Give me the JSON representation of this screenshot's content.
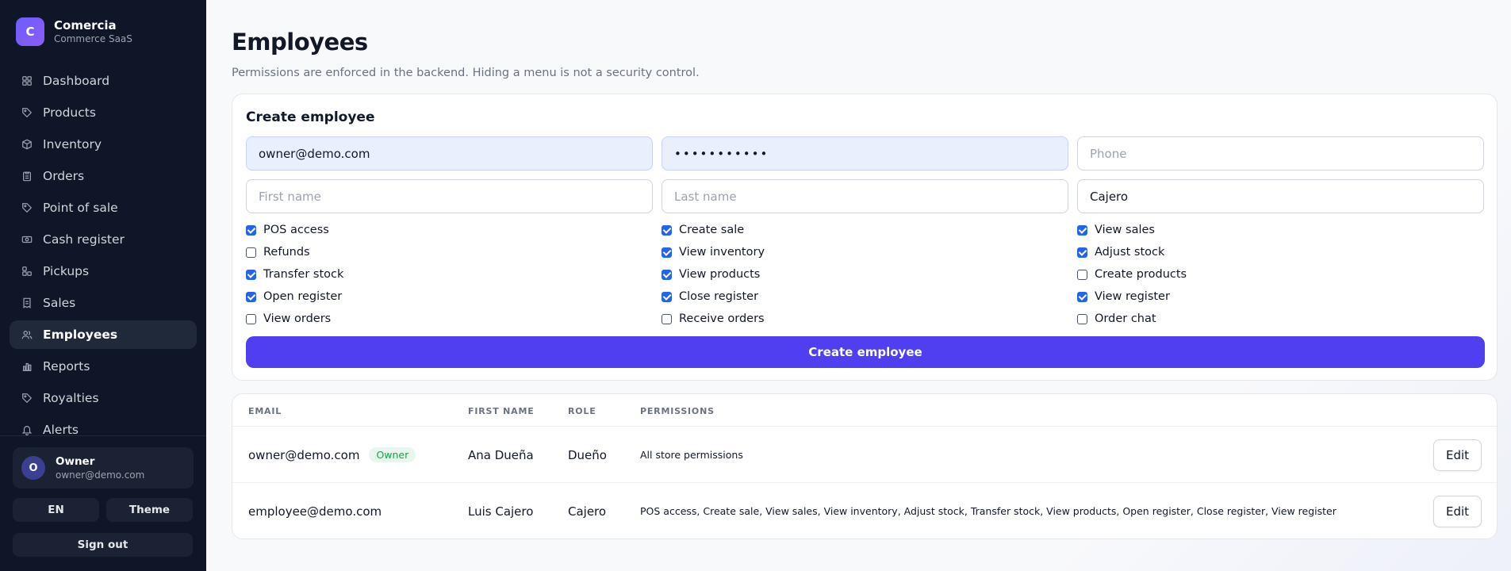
{
  "brand": {
    "initial": "C",
    "name": "Comercia",
    "subtitle": "Commerce SaaS"
  },
  "sidebar": {
    "items": [
      {
        "label": "Dashboard",
        "icon": "grid-icon",
        "active": false
      },
      {
        "label": "Products",
        "icon": "tag-icon",
        "active": false
      },
      {
        "label": "Inventory",
        "icon": "box-icon",
        "active": false
      },
      {
        "label": "Orders",
        "icon": "clipboard-icon",
        "active": false
      },
      {
        "label": "Point of sale",
        "icon": "tag-icon",
        "active": false
      },
      {
        "label": "Cash register",
        "icon": "cash-icon",
        "active": false
      },
      {
        "label": "Pickups",
        "icon": "blocks-icon",
        "active": false
      },
      {
        "label": "Sales",
        "icon": "receipt-icon",
        "active": false
      },
      {
        "label": "Employees",
        "icon": "users-icon",
        "active": true
      },
      {
        "label": "Reports",
        "icon": "bar-chart-icon",
        "active": false
      },
      {
        "label": "Royalties",
        "icon": "tag-icon",
        "active": false
      },
      {
        "label": "Alerts",
        "icon": "bell-icon",
        "active": false
      }
    ]
  },
  "user": {
    "initial": "O",
    "name": "Owner",
    "email": "owner@demo.com"
  },
  "controls": {
    "language": "EN",
    "theme": "Theme",
    "sign_out": "Sign out"
  },
  "page": {
    "title": "Employees",
    "subtitle": "Permissions are enforced in the backend. Hiding a menu is not a security control."
  },
  "form": {
    "title": "Create employee",
    "email_value": "owner@demo.com",
    "password_value": "•••••••••••",
    "phone_placeholder": "Phone",
    "first_name_placeholder": "First name",
    "last_name_placeholder": "Last name",
    "role_value": "Cajero",
    "permissions": [
      {
        "label": "POS access",
        "checked": true
      },
      {
        "label": "Create sale",
        "checked": true
      },
      {
        "label": "View sales",
        "checked": true
      },
      {
        "label": "Refunds",
        "checked": false
      },
      {
        "label": "View inventory",
        "checked": true
      },
      {
        "label": "Adjust stock",
        "checked": true
      },
      {
        "label": "Transfer stock",
        "checked": true
      },
      {
        "label": "View products",
        "checked": true
      },
      {
        "label": "Create products",
        "checked": false
      },
      {
        "label": "Open register",
        "checked": true
      },
      {
        "label": "Close register",
        "checked": true
      },
      {
        "label": "View register",
        "checked": true
      },
      {
        "label": "View orders",
        "checked": false
      },
      {
        "label": "Receive orders",
        "checked": false
      },
      {
        "label": "Order chat",
        "checked": false
      }
    ],
    "submit_label": "Create employee"
  },
  "table": {
    "headers": [
      "EMAIL",
      "FIRST NAME",
      "ROLE",
      "PERMISSIONS"
    ],
    "rows": [
      {
        "email": "owner@demo.com",
        "badge": "Owner",
        "first_name": "Ana Dueña",
        "role": "Dueño",
        "permissions": "All store permissions",
        "action": "Edit"
      },
      {
        "email": "employee@demo.com",
        "badge": "",
        "first_name": "Luis Cajero",
        "role": "Cajero",
        "permissions": "POS access, Create sale, View sales, View inventory, Adjust stock, Transfer stock, View products, Open register, Close register, View register",
        "action": "Edit"
      }
    ]
  },
  "colors": {
    "sidebar_bg": "#0e1628",
    "accent": "#4f3ff0",
    "checkbox": "#2563eb",
    "badge_green": "#16a34a"
  }
}
